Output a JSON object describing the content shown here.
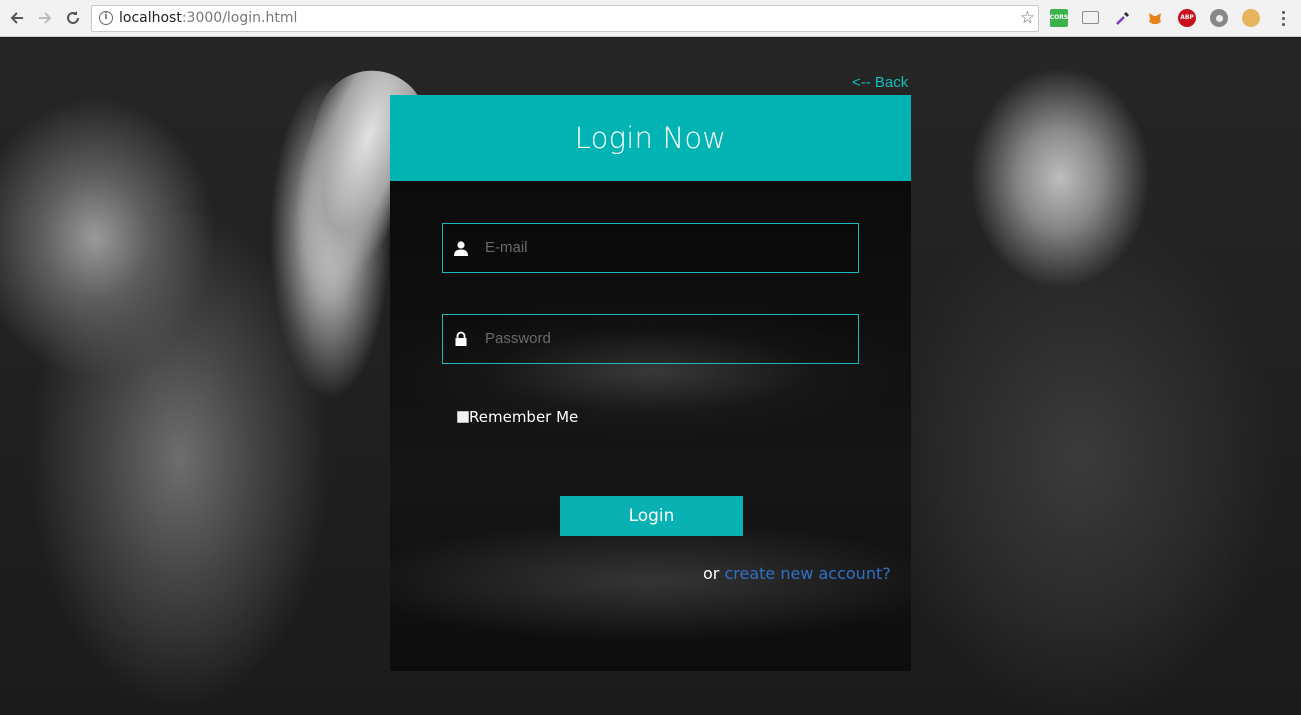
{
  "browser": {
    "url_host": "localhost",
    "url_path": ":3000/login.html",
    "extensions": [
      "cors-icon",
      "cast-icon",
      "eyedropper-icon",
      "metamask-icon",
      "adblock-plus-icon",
      "extension-icon",
      "cookie-icon"
    ],
    "extension_labels": {
      "cors": "CORS",
      "abp": "ABP"
    }
  },
  "page": {
    "back_link": "<-- Back",
    "title": "Login Now",
    "email": {
      "placeholder": "E-mail",
      "value": ""
    },
    "password": {
      "placeholder": "Password",
      "value": ""
    },
    "remember_label": "Remember Me",
    "login_button": "Login",
    "create_prefix": "or ",
    "create_link": "create new account?"
  },
  "colors": {
    "accent": "#02b3b4",
    "link": "#3170c9",
    "back_link": "#12bdbd"
  }
}
